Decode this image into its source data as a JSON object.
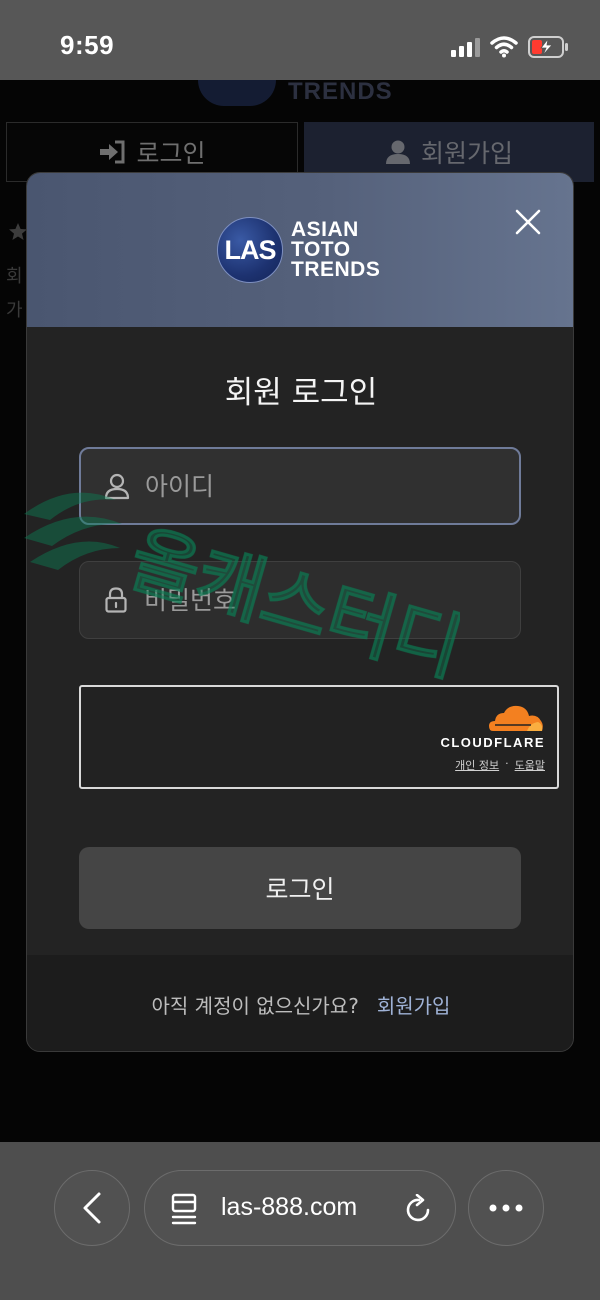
{
  "status_bar": {
    "time": "9:59"
  },
  "background_page": {
    "logo_text": "TRENDS",
    "tabs": [
      {
        "label": "로그인"
      },
      {
        "label": "회원가입"
      }
    ],
    "side_text": [
      "회",
      "가"
    ]
  },
  "modal": {
    "logo": {
      "badge": "LAS",
      "lines": [
        "ASIAN",
        "TOTO",
        "TRENDS"
      ]
    },
    "title": "회원 로그인",
    "username": {
      "placeholder": "아이디",
      "value": ""
    },
    "password": {
      "placeholder": "비밀번호",
      "value": ""
    },
    "captcha": {
      "brand": "CLOUDFLARE",
      "privacy_label": "개인 정보",
      "separator": "·",
      "help_label": "도움말"
    },
    "login_button": "로그인",
    "footer": {
      "question": "아직 계정이 없으신가요?",
      "signup_link": "회원가입"
    }
  },
  "watermark": {
    "text": "올캐스터디"
  },
  "browser": {
    "url": "las-888.com"
  },
  "colors": {
    "header_gradient_start": "#4a5670",
    "header_gradient_end": "#66748f",
    "modal_bg": "#232323",
    "button_bg": "#454545",
    "link": "#9fb2d6",
    "cloudflare_orange": "#f38020",
    "watermark_green": "#0b7f55"
  },
  "icons": {
    "status": [
      "signal-icon",
      "wifi-icon",
      "battery-charging-icon"
    ],
    "tabs": [
      "login-arrow-icon",
      "user-icon"
    ],
    "modal": [
      "close-icon",
      "user-icon",
      "lock-icon",
      "cloudflare-cloud-icon"
    ],
    "browser": [
      "back-chevron-icon",
      "page-menu-icon",
      "reload-icon",
      "more-icon"
    ]
  }
}
